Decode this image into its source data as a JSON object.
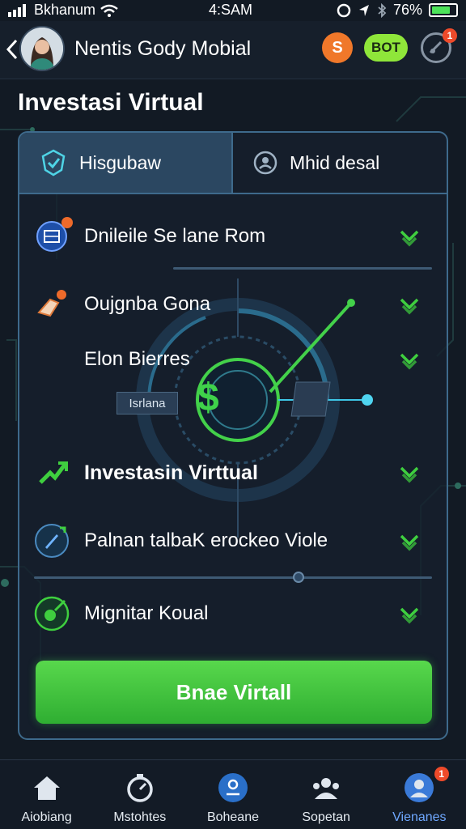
{
  "status_bar": {
    "carrier": "Bkhanum",
    "time": "4:SAM",
    "battery": "76%"
  },
  "header": {
    "app_title": "Nentis Gody Mobial",
    "btn_s_label": "S",
    "btn_bot_label": "BOT",
    "notification_count": "1"
  },
  "page_title": "Investasi Virtual",
  "tabs": [
    {
      "label": "Hisgubaw",
      "active": true
    },
    {
      "label": "Mhid desal",
      "active": false
    }
  ],
  "items": [
    {
      "label": "Dnileile Se lane Rom",
      "checked": true
    },
    {
      "label": "Oujgnba Gona",
      "checked": true
    },
    {
      "label": "Elon Bierres",
      "checked": true
    },
    {
      "label": "Investasin Virttual",
      "checked": true
    },
    {
      "label": "Palnan talbaK erockeo Viole",
      "checked": true
    },
    {
      "label": "Mignitar Koual",
      "checked": true
    }
  ],
  "graphic_chip": "Isrlana",
  "currency_symbol": "$",
  "cta_label": "Bnae Virtall",
  "bottom_nav": [
    {
      "label": "Aiobiang",
      "icon": "home-icon",
      "active": false
    },
    {
      "label": "Mstohtes",
      "icon": "timer-icon",
      "active": false
    },
    {
      "label": "Boheane",
      "icon": "coin-icon",
      "active": false
    },
    {
      "label": "Sopetan",
      "icon": "team-icon",
      "active": false
    },
    {
      "label": "Vienanes",
      "icon": "profile-icon",
      "active": true,
      "badge": "1"
    }
  ],
  "colors": {
    "accent_green": "#3fcf3f",
    "cta_green": "#46c83e",
    "tab_active": "#2b4761",
    "background": "#121a24"
  }
}
